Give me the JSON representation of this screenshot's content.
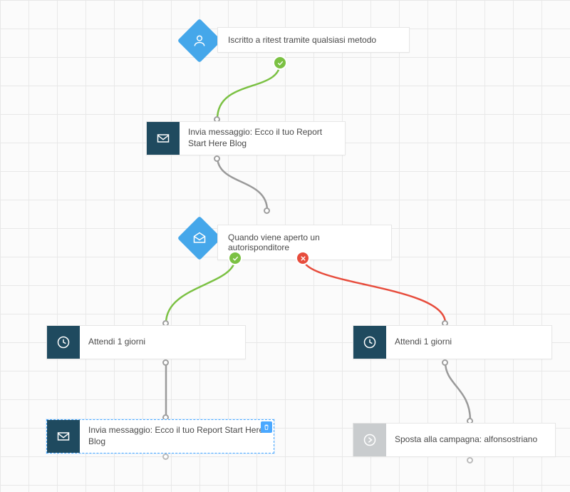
{
  "colors": {
    "node_icon_bg": "#1f4a5f",
    "diamond_bg": "#45a7ea",
    "success_badge": "#7bc143",
    "fail_badge": "#e74c3c",
    "selected_border": "#4aa8ff",
    "connector": "#9e9e9e"
  },
  "nodes": {
    "trigger": {
      "label": "Iscritto a ritest tramite qualsiasi metodo",
      "icon": "person-icon"
    },
    "send1": {
      "label": "Invia messaggio: Ecco il tuo Report Start Here Blog",
      "icon": "envelope-icon"
    },
    "condition": {
      "label": "Quando viene aperto un autorisponditore",
      "icon": "envelope-open-icon"
    },
    "wait_yes": {
      "label": "Attendi 1 giorni",
      "icon": "clock-icon"
    },
    "wait_no": {
      "label": "Attendi 1 giorni",
      "icon": "clock-icon"
    },
    "send2": {
      "label": "Invia messaggio: Ecco il tuo Report Start Here Blog",
      "icon": "envelope-icon",
      "selected": true
    },
    "move": {
      "label": "Sposta alla campagna: alfonsostriano",
      "icon": "arrow-right-circle-icon"
    }
  },
  "badges": {
    "trigger_out": "success",
    "condition_yes": "success",
    "condition_no": "fail"
  }
}
